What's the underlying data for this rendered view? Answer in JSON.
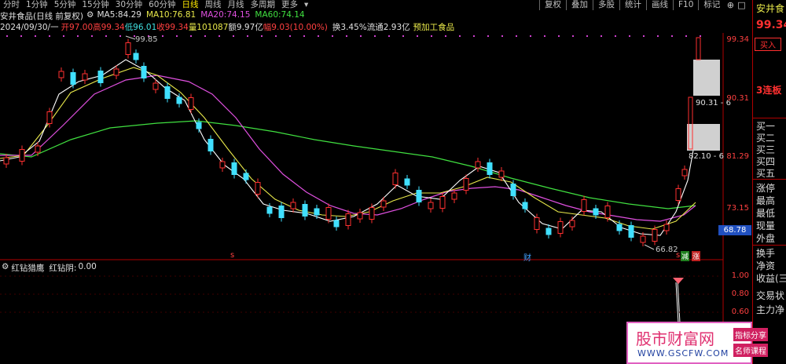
{
  "toolbar": {
    "periods": [
      "分时",
      "1分钟",
      "5分钟",
      "15分钟",
      "30分钟",
      "60分钟",
      "日线",
      "周线",
      "月线",
      "多周期",
      "更多"
    ],
    "active_period": "日线",
    "right_tools": [
      "复权",
      "叠加",
      "多股",
      "统计",
      "画线",
      "F10",
      "标记"
    ],
    "win_icons": [
      "⊕",
      "□"
    ]
  },
  "title": {
    "stock": "安井食品(日线 前复权)",
    "ma5_label": "MA5:",
    "ma5": "84.29",
    "ma10_label": "MA10:",
    "ma10": "76.81",
    "ma20_label": "MA20:",
    "ma20": "74.15",
    "ma60_label": "MA60:",
    "ma60": "74.14"
  },
  "info": {
    "date": "2024/09/30/一",
    "open": "开97.00",
    "high": "高99.34",
    "low": "低96.01",
    "close": "收99.34",
    "volume": "量101087",
    "amount": "额9.97亿",
    "change": "幅9.03(10.00%)",
    "turnover": "换3.45%",
    "float": "流通2.93亿",
    "industry": "预加工食品"
  },
  "annotations": {
    "high_mark": "99.85",
    "low_mark": "66.82",
    "price_tag_1": "90.31 - 6",
    "price_tag_2": "82.10 - 6",
    "current_price": "68.78",
    "sig_s1": "s",
    "sig_cai": "财",
    "sig_s2": "s",
    "sig_jian": "减",
    "sig_zhang": "涨"
  },
  "axis": {
    "price_ticks": [
      "99.34",
      "90.31",
      "81.29",
      "73.15"
    ],
    "ind_ticks": [
      "1.00",
      "0.80",
      "0.60"
    ]
  },
  "indicator": {
    "name": "红钻猎鹰",
    "series_label": "红钻阴:",
    "series_value": "0.00"
  },
  "right_panel": {
    "stock": "安井食",
    "price": "99.34",
    "buy": "买入",
    "streak": "3连板",
    "rows": [
      "买一",
      "买二",
      "买三",
      "买四",
      "买五",
      "涨停",
      "最高",
      "最低",
      "现量",
      "外盘",
      "换手",
      "净资",
      "收益(三",
      "交易状",
      "主力净"
    ]
  },
  "watermark": {
    "site": "股市财富网",
    "url": "WWW.GSCFW.COM",
    "tag1": "指标分享",
    "tag2": "名师课程"
  },
  "colors": {
    "up": "#ff3030",
    "down": "#40e0ff",
    "ma5": "#ffffff",
    "ma10": "#e8e84a",
    "ma20": "#e050e0",
    "ma60": "#40e040"
  }
}
